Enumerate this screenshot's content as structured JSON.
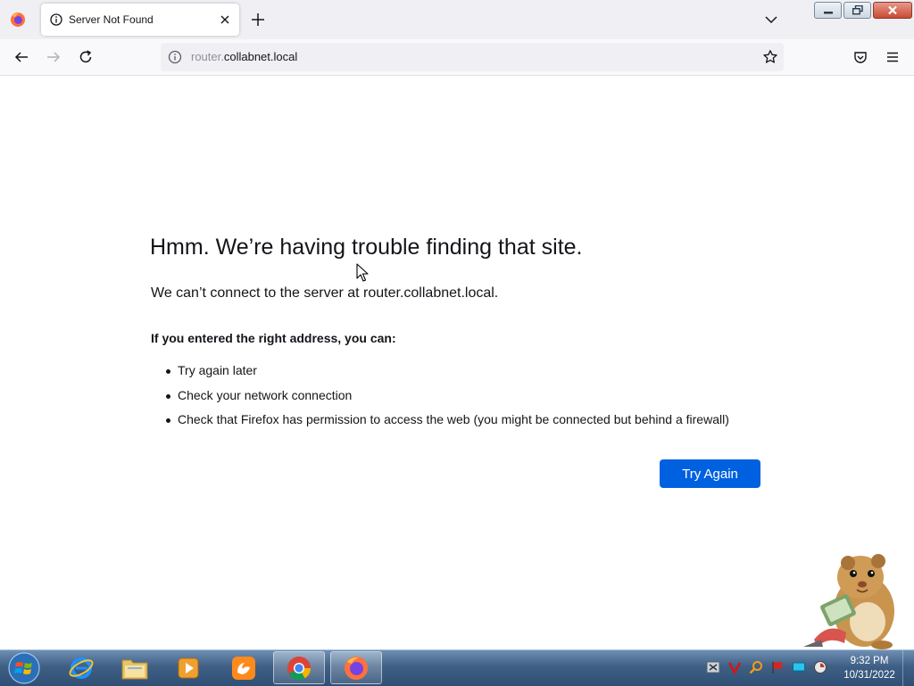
{
  "browser": {
    "tab": {
      "title": "Server Not Found"
    },
    "urlbar": {
      "url_prefix": "router.",
      "url_domain": "collabnet.local"
    }
  },
  "icons": {
    "firefox_menu": "firefox-icon",
    "tab_info": "info-icon",
    "tab_close": "close-icon",
    "new_tab": "plus-icon",
    "list_tabs": "chevron-down-icon",
    "back": "back-arrow-icon",
    "forward": "forward-arrow-icon",
    "reload": "reload-icon",
    "site_info": "info-icon",
    "bookmark": "star-icon",
    "pocket": "pocket-icon",
    "menu": "hamburger-menu-icon"
  },
  "error_page": {
    "title": "Hmm. We’re having trouble finding that site.",
    "description": "We can’t connect to the server at router.collabnet.local.",
    "suggestions_heading": "If you entered the right address, you can:",
    "suggestions": [
      "Try again later",
      "Check your network connection",
      "Check that Firefox has permission to access the web (you might be connected but behind a firewall)"
    ],
    "try_again_label": "Try Again"
  },
  "taskbar": {
    "apps": [
      "internet-explorer-icon",
      "file-explorer-icon",
      "media-player-icon",
      "uc-browser-icon",
      "chrome-icon",
      "firefox-icon"
    ],
    "tray_icons": [
      "network-tool-icon",
      "antivirus-icon",
      "search-tool-icon",
      "flag-icon",
      "display-icon",
      "volume-icon"
    ],
    "clock": {
      "time": "9:32 PM",
      "date": "10/31/2022"
    }
  },
  "colors": {
    "accent": "#0061e0",
    "tabstrip": "#f0f0f4",
    "navbar": "#f9f9fb",
    "text": "#15141a"
  }
}
